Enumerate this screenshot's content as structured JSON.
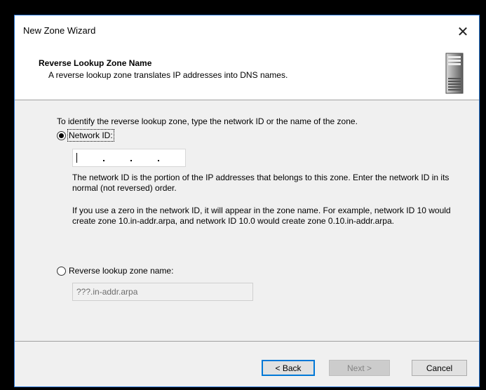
{
  "window": {
    "title": "New Zone Wizard",
    "close_glyph": "✕"
  },
  "header": {
    "title": "Reverse Lookup Zone Name",
    "subtitle": "A reverse lookup zone translates IP addresses into DNS names.",
    "icon": "server-icon"
  },
  "body": {
    "intro": "To identify the reverse lookup zone, type the network ID or the name of the zone.",
    "network_id": {
      "label": "Network ID:",
      "selected": true,
      "value": ""
    },
    "help_1": "The network ID is the portion of the IP addresses that belongs to this zone. Enter the network ID in its normal (not reversed) order.",
    "help_2": "If you use a zero in the network ID, it will appear in the zone name. For example, network ID 10 would create zone 10.in-addr.arpa, and network ID 10.0 would create zone 0.10.in-addr.arpa.",
    "zone_name": {
      "label": "Reverse lookup zone name:",
      "selected": false,
      "value": "???.in-addr.arpa"
    }
  },
  "buttons": {
    "back": "< Back",
    "next": "Next >",
    "cancel": "Cancel"
  },
  "colors": {
    "accent": "#0078d7",
    "window_border": "#2b79d7",
    "background": "#f0f0f0"
  }
}
